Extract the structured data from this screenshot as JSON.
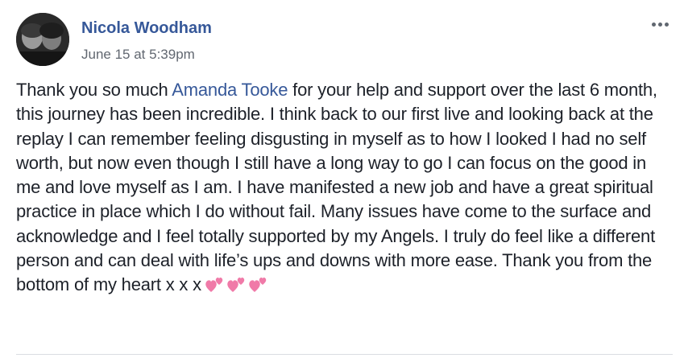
{
  "post": {
    "author": "Nicola Woodham",
    "timestamp": "June 15 at 5:39pm",
    "text_before_mention": "Thank you so much ",
    "mention": "Amanda Tooke",
    "text_after_mention": " for your help and support over the last 6 month, this journey has been incredible. I think back to our first live and looking back at the replay I can remember feeling disgusting in myself as to how I looked I had no self worth, but now even though I still have a long way to go I can focus on the good in me and love myself as I am. I have manifested a new job and have a great spiritual practice in place which I do without fail. Many issues have come to the surface and acknowledge and I feel totally supported by my Angels. I truly do feel like a different person and can deal with life’s ups and downs with more ease. Thank you from the bottom of my heart x x x",
    "emojis": [
      "two-hearts-icon",
      "two-hearts-icon",
      "two-hearts-icon"
    ]
  },
  "colors": {
    "link": "#365899",
    "text": "#1d2129",
    "meta": "#616770",
    "heart": "#f07aa8"
  },
  "icons": {
    "more": "more-options-icon",
    "avatar": "profile-photo"
  }
}
